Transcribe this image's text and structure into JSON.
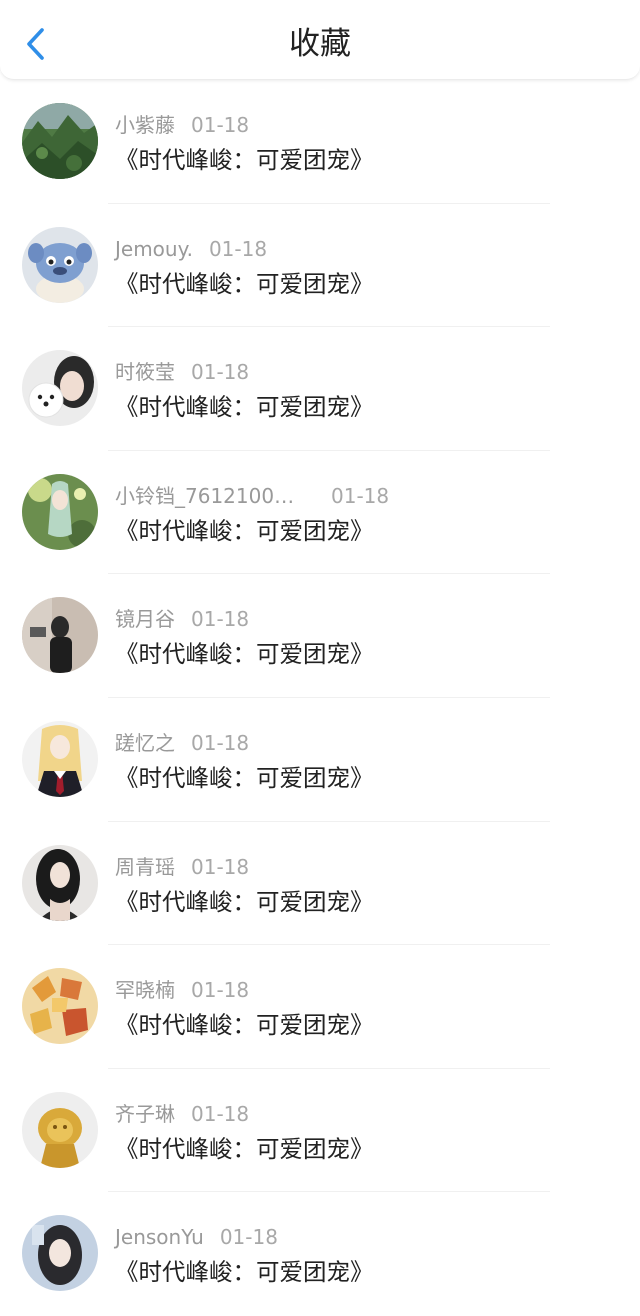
{
  "header": {
    "title": "收藏"
  },
  "items": [
    {
      "user": "小紫藤",
      "date": "01-18",
      "title": "《时代峰峻：可爱团宠》",
      "avatar": "landscape-avatar"
    },
    {
      "user": "Jemouy.",
      "date": "01-18",
      "title": "《时代峰峻：可爱团宠》",
      "avatar": "plush-toy-avatar"
    },
    {
      "user": "时筱莹",
      "date": "01-18",
      "title": "《时代峰峻：可爱团宠》",
      "avatar": "girl-with-dog-avatar"
    },
    {
      "user": "小铃铛_7612100…",
      "date": "01-18",
      "title": "《时代峰峻：可爱团宠》",
      "avatar": "anime-character-avatar"
    },
    {
      "user": "镜月谷",
      "date": "01-18",
      "title": "《时代峰峻：可爱团宠》",
      "avatar": "mirror-selfie-avatar"
    },
    {
      "user": "蹉忆之",
      "date": "01-18",
      "title": "《时代峰峻：可爱团宠》",
      "avatar": "anime-blonde-avatar"
    },
    {
      "user": "周青瑶",
      "date": "01-18",
      "title": "《时代峰峻：可爱团宠》",
      "avatar": "portrait-avatar"
    },
    {
      "user": "罕晓楠",
      "date": "01-18",
      "title": "《时代峰峻：可爱团宠》",
      "avatar": "autumn-leaves-avatar"
    },
    {
      "user": "齐子琳",
      "date": "01-18",
      "title": "《时代峰峻：可爱团宠》",
      "avatar": "golden-lion-avatar"
    },
    {
      "user": "JensonYu",
      "date": "01-18",
      "title": "《时代峰峻：可爱团宠》",
      "avatar": "selfie-avatar"
    }
  ],
  "colors": {
    "accent": "#2f8ee8",
    "text": "#222222",
    "meta": "#999999"
  }
}
